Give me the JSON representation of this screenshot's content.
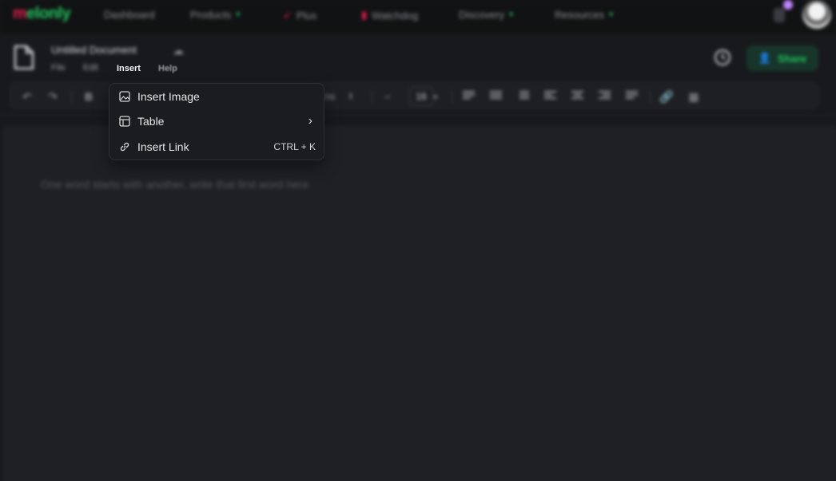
{
  "topnav": {
    "logo_rest": "elonly",
    "logo_first": "m",
    "items": [
      {
        "label": "Dashboard"
      },
      {
        "label": "Products"
      },
      {
        "label": "Plus"
      },
      {
        "label": "Watchdog"
      },
      {
        "label": "Discovery"
      },
      {
        "label": "Resources"
      }
    ]
  },
  "document": {
    "title": "Untitled Document",
    "menu": {
      "file": "File",
      "edit": "Edit",
      "insert": "Insert",
      "help": "Help"
    },
    "share_label": "Share"
  },
  "toolbar": {
    "bold": "B",
    "font_tail": "ns",
    "font_size": "16",
    "minus": "−",
    "plus": "+"
  },
  "editor": {
    "placeholder": "One word starts with another, write that first word here"
  },
  "insert_menu": {
    "items": [
      {
        "label": "Insert Image",
        "icon": "image-icon",
        "shortcut": ""
      },
      {
        "label": "Table",
        "icon": "table-icon",
        "shortcut": "›"
      },
      {
        "label": "Insert Link",
        "icon": "link-icon",
        "shortcut": "CTRL + K"
      }
    ]
  },
  "colors": {
    "accent": "#22c55e",
    "logo_m": "#e11d48",
    "notification": "#c084fc"
  }
}
